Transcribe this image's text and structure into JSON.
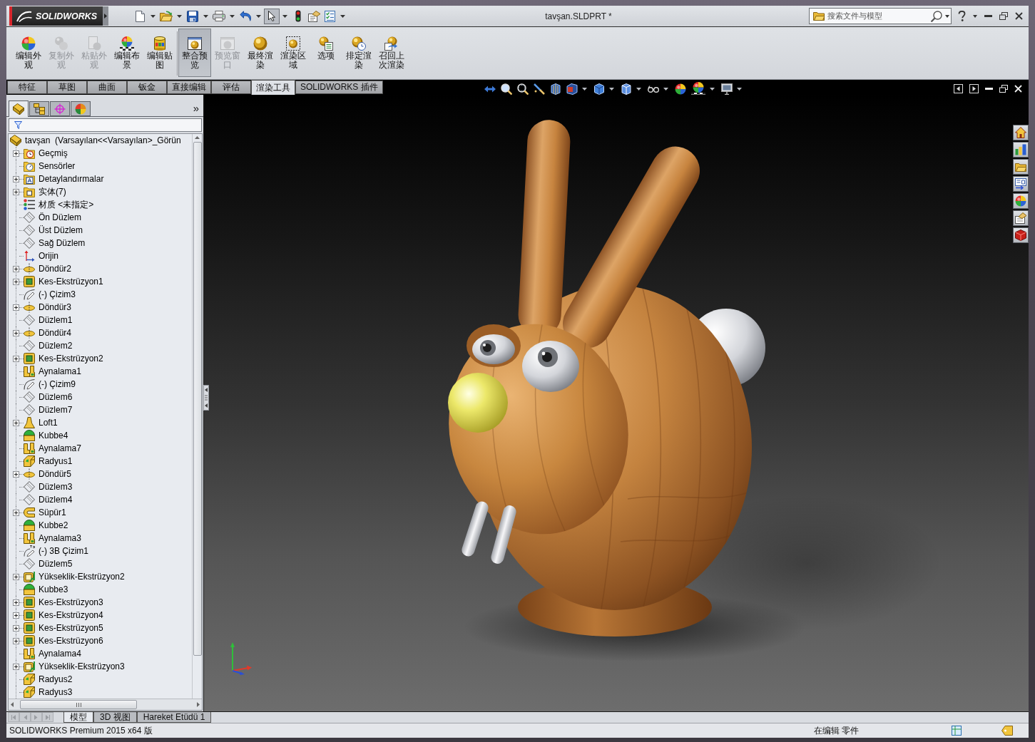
{
  "window": {
    "logo": "SOLIDWORKS",
    "title": "tavşan.SLDPRT *"
  },
  "quick_access": [
    {
      "kind": "new",
      "dropdown": true,
      "selected": false
    },
    {
      "kind": "open",
      "dropdown": true,
      "selected": false
    },
    {
      "kind": "save",
      "dropdown": true,
      "selected": false
    },
    {
      "kind": "print",
      "dropdown": true,
      "selected": false
    },
    {
      "kind": "undo",
      "dropdown": true,
      "selected": false
    },
    {
      "kind": "select",
      "dropdown": true,
      "selected": true
    },
    {
      "kind": "rebuild",
      "dropdown": false,
      "selected": false
    },
    {
      "kind": "properties",
      "dropdown": false,
      "selected": false
    },
    {
      "kind": "options",
      "dropdown": true,
      "selected": false
    }
  ],
  "search": {
    "placeholder": "搜索文件与模型"
  },
  "ribbon": {
    "groups": [
      {
        "buttons": [
          {
            "kind": "edit-appearance",
            "label": "编辑外观",
            "disabled": false,
            "selected": false
          },
          {
            "kind": "copy-appearance",
            "label": "复制外观",
            "disabled": true,
            "selected": false
          },
          {
            "kind": "paste-appearance",
            "label": "粘贴外观",
            "disabled": true,
            "selected": false
          },
          {
            "kind": "edit-scene",
            "label": "编辑布景",
            "disabled": false,
            "selected": false
          },
          {
            "kind": "edit-decal",
            "label": "编辑贴图",
            "disabled": false,
            "selected": false
          }
        ]
      },
      {
        "buttons": [
          {
            "kind": "integrated-preview",
            "label": "整合预览",
            "disabled": false,
            "selected": true
          },
          {
            "kind": "preview-window",
            "label": "预览窗口",
            "disabled": true,
            "selected": false
          },
          {
            "kind": "final-render",
            "label": "最终渲染",
            "disabled": false,
            "selected": false
          },
          {
            "kind": "render-region",
            "label": "渲染区域",
            "disabled": false,
            "selected": false
          },
          {
            "kind": "options",
            "label": "选项",
            "disabled": false,
            "selected": false
          },
          {
            "kind": "schedule-render",
            "label": "排定渲染",
            "disabled": false,
            "selected": false
          },
          {
            "kind": "recall-render",
            "label": "召回上次渲染",
            "disabled": false,
            "selected": false
          }
        ]
      }
    ]
  },
  "command_tabs": [
    {
      "label": "特征",
      "selected": false
    },
    {
      "label": "草图",
      "selected": false
    },
    {
      "label": "曲面",
      "selected": false
    },
    {
      "label": "钣金",
      "selected": false
    },
    {
      "label": "直接编辑",
      "selected": false
    },
    {
      "label": "评估",
      "selected": false
    },
    {
      "label": "渲染工具",
      "selected": true
    },
    {
      "label": "SOLIDWORKS 插件",
      "selected": false
    }
  ],
  "heads_up_toolbar": [
    {
      "kind": "previous-view",
      "dropdown": false
    },
    {
      "kind": "zoom-fit",
      "dropdown": false
    },
    {
      "kind": "zoom-area",
      "dropdown": false
    },
    {
      "kind": "pointer",
      "dropdown": false
    },
    {
      "kind": "section",
      "dropdown": false
    },
    {
      "kind": "orientation",
      "dropdown": true
    },
    {
      "kind": "display-style",
      "dropdown": true
    },
    {
      "kind": "hide-show",
      "dropdown": true
    },
    {
      "kind": "edit-appearance",
      "dropdown": true
    },
    {
      "kind": "appearance",
      "dropdown": false
    },
    {
      "kind": "scene",
      "dropdown": true
    },
    {
      "kind": "view-settings",
      "dropdown": true
    }
  ],
  "feature_manager": {
    "panel_tabs": [
      {
        "kind": "feature-tree",
        "selected": true
      },
      {
        "kind": "property",
        "selected": false
      },
      {
        "kind": "configuration",
        "selected": false
      },
      {
        "kind": "display",
        "selected": false
      }
    ],
    "expand_glyph": "»",
    "root": {
      "label": "tavşan  (Varsayılan<<Varsayılan>_Görün"
    },
    "items": [
      {
        "label": "Geçmiş",
        "kind": "history",
        "expandable": true
      },
      {
        "label": "Sensörler",
        "kind": "sensors",
        "expandable": false
      },
      {
        "label": "Detaylandırmalar",
        "kind": "annotations",
        "expandable": true
      },
      {
        "label": "实体(7)",
        "kind": "bodies",
        "expandable": true
      },
      {
        "label": "材质 <未指定>",
        "kind": "material",
        "expandable": false
      },
      {
        "label": "Ön Düzlem",
        "kind": "plane",
        "expandable": false
      },
      {
        "label": "Üst Düzlem",
        "kind": "plane",
        "expandable": false
      },
      {
        "label": "Sağ Düzlem",
        "kind": "plane",
        "expandable": false
      },
      {
        "label": "Orijin",
        "kind": "origin",
        "expandable": false
      },
      {
        "label": "Döndür2",
        "kind": "revolve",
        "expandable": true
      },
      {
        "label": "Kes-Ekstrüzyon1",
        "kind": "cut",
        "expandable": true
      },
      {
        "label": "(-) Çizim3",
        "kind": "sketch",
        "expandable": false
      },
      {
        "label": "Döndür3",
        "kind": "revolve",
        "expandable": true
      },
      {
        "label": "Düzlem1",
        "kind": "plane",
        "expandable": false
      },
      {
        "label": "Döndür4",
        "kind": "revolve",
        "expandable": true
      },
      {
        "label": "Düzlem2",
        "kind": "plane",
        "expandable": false
      },
      {
        "label": "Kes-Ekstrüzyon2",
        "kind": "cut",
        "expandable": true
      },
      {
        "label": "Aynalama1",
        "kind": "mirror",
        "expandable": false
      },
      {
        "label": "(-) Çizim9",
        "kind": "sketch",
        "expandable": false
      },
      {
        "label": "Düzlem6",
        "kind": "plane",
        "expandable": false
      },
      {
        "label": "Düzlem7",
        "kind": "plane",
        "expandable": false
      },
      {
        "label": "Loft1",
        "kind": "loft",
        "expandable": true
      },
      {
        "label": "Kubbe4",
        "kind": "dome",
        "expandable": false
      },
      {
        "label": "Aynalama7",
        "kind": "mirror",
        "expandable": false
      },
      {
        "label": "Radyus1",
        "kind": "fillet",
        "expandable": false
      },
      {
        "label": "Döndür5",
        "kind": "revolve",
        "expandable": true
      },
      {
        "label": "Düzlem3",
        "kind": "plane",
        "expandable": false
      },
      {
        "label": "Düzlem4",
        "kind": "plane",
        "expandable": false
      },
      {
        "label": "Süpür1",
        "kind": "sweep",
        "expandable": true
      },
      {
        "label": "Kubbe2",
        "kind": "dome",
        "expandable": false
      },
      {
        "label": "Aynalama3",
        "kind": "mirror",
        "expandable": false
      },
      {
        "label": "(-) 3B Çizim1",
        "kind": "sketch3d",
        "expandable": false
      },
      {
        "label": "Düzlem5",
        "kind": "plane",
        "expandable": false
      },
      {
        "label": "Yükseklik-Ekstrüzyon2",
        "kind": "boss",
        "expandable": true
      },
      {
        "label": "Kubbe3",
        "kind": "dome",
        "expandable": false
      },
      {
        "label": "Kes-Ekstrüzyon3",
        "kind": "cut",
        "expandable": true
      },
      {
        "label": "Kes-Ekstrüzyon4",
        "kind": "cut",
        "expandable": true
      },
      {
        "label": "Kes-Ekstrüzyon5",
        "kind": "cut",
        "expandable": true
      },
      {
        "label": "Kes-Ekstrüzyon6",
        "kind": "cut",
        "expandable": true
      },
      {
        "label": "Aynalama4",
        "kind": "mirror",
        "expandable": false
      },
      {
        "label": "Yükseklik-Ekstrüzyon3",
        "kind": "boss",
        "expandable": true
      },
      {
        "label": "Radyus2",
        "kind": "fillet",
        "expandable": false
      },
      {
        "label": "Radyus3",
        "kind": "fillet",
        "expandable": false
      }
    ]
  },
  "bottom_tabs": [
    {
      "label": "模型",
      "selected": true
    },
    {
      "label": "3D 视图",
      "selected": false
    },
    {
      "label": "Hareket Etüdü 1",
      "selected": false
    }
  ],
  "status_bar": {
    "product": "SOLIDWORKS Premium 2015 x64 版",
    "mode": "在编辑 零件"
  }
}
